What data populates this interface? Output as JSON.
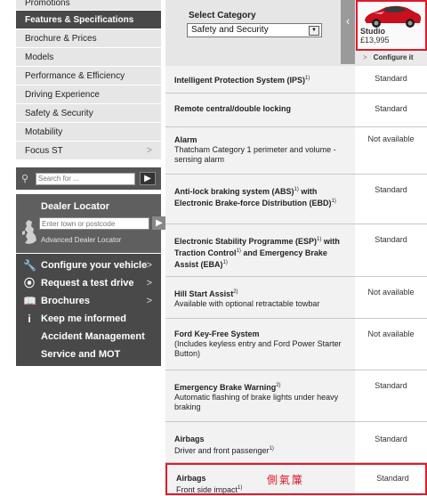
{
  "nav": {
    "items": [
      {
        "label": "Promotions"
      },
      {
        "label": "Features & Specifications"
      },
      {
        "label": "Brochure & Prices"
      },
      {
        "label": "Models"
      },
      {
        "label": "Performance & Efficiency"
      },
      {
        "label": "Driving Experience"
      },
      {
        "label": "Safety & Security"
      },
      {
        "label": "Motability"
      },
      {
        "label": "Focus ST"
      }
    ]
  },
  "search": {
    "placeholder": "Search for ..."
  },
  "dealer": {
    "title": "Dealer Locator",
    "placeholder": "Enter town or postcode",
    "advanced": "Advanced Dealer Locator"
  },
  "actions": [
    {
      "label": "Configure your vehicle",
      "icon": "wrench-icon"
    },
    {
      "label": "Request a test drive",
      "icon": "steering-wheel-icon"
    },
    {
      "label": "Brochures",
      "icon": "book-icon"
    },
    {
      "label": "Keep me informed",
      "icon": "info-icon"
    },
    {
      "label": "Accident Management"
    },
    {
      "label": "Service and MOT Booking"
    }
  ],
  "category": {
    "label": "Select Category",
    "selected": "Safety and Security"
  },
  "car": {
    "name": "Studio",
    "price": "£13,995",
    "configure": "Configure it",
    "color": "#c8101e"
  },
  "features": [
    {
      "name": "Intelligent Protection System (IPS)",
      "sup": "1)",
      "value": "Standard"
    },
    {
      "name": "Remote central/double locking",
      "value": "Standard"
    },
    {
      "name": "Alarm",
      "desc": "Thatcham Category 1 perimeter and volume -sensing alarm",
      "value": "Not available"
    },
    {
      "name": "Anti-lock braking system (ABS)",
      "sup": "1)",
      "name2": " with Electronic Brake-force Distribution (EBD)",
      "sup2": "1)",
      "value": "Standard"
    },
    {
      "name": "Electronic Stability Programme (ESP)",
      "sup": "1)",
      "name2": " with Traction Control",
      "sup2": "1)",
      "name3": " and Emergency Brake Assist (EBA)",
      "sup3": "1)",
      "value": "Standard"
    },
    {
      "name": "Hill Start Assist",
      "sup": "2)",
      "desc": "Available with optional retractable towbar",
      "value": "Not available"
    },
    {
      "name": "Ford Key-Free System",
      "desc": "(Includes keyless entry and Ford Power Starter Button)",
      "value": "Not available"
    },
    {
      "name": "Emergency Brake Warning",
      "sup": "2)",
      "desc": "Automatic flashing of brake lights under heavy braking",
      "value": "Standard"
    },
    {
      "name": "Airbags",
      "desc": "Driver and front passenger",
      "dsup": "1)",
      "value": "Standard"
    },
    {
      "name": "Airbags",
      "desc": "Front side impact",
      "dsup": "1)",
      "value": "Standard",
      "annotation": "側氣簾"
    }
  ],
  "colors": {
    "highlight": "#e01a2b",
    "nav_active": "#494949"
  }
}
